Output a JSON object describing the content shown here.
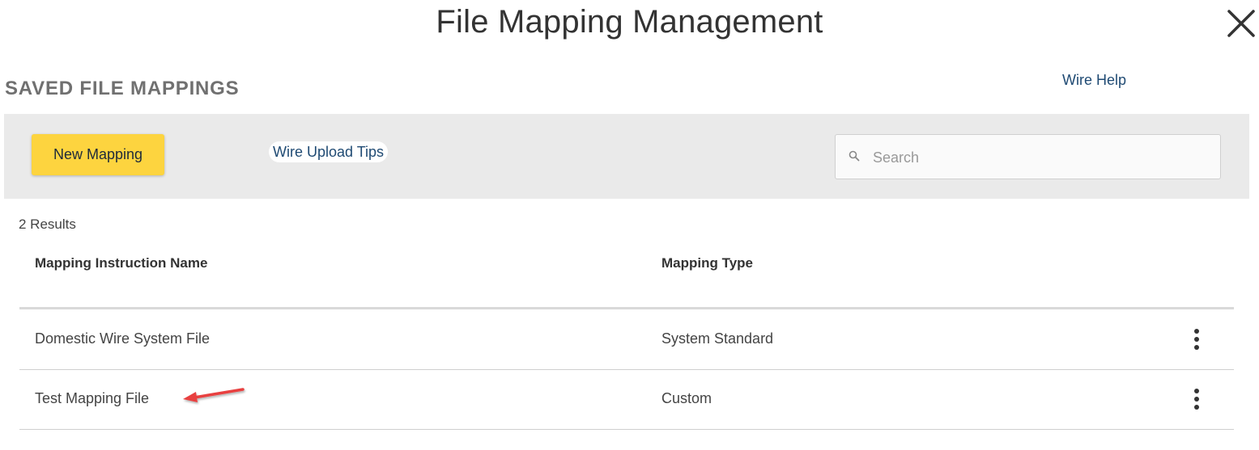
{
  "header": {
    "title": "File Mapping Management",
    "close_icon": "close-icon"
  },
  "section": {
    "title": "SAVED FILE MAPPINGS",
    "help_link": "Wire Help"
  },
  "toolbar": {
    "new_mapping_label": "New Mapping",
    "upload_tips_label": "Wire Upload Tips",
    "search": {
      "placeholder": "Search",
      "value": "",
      "icon": "search-icon"
    }
  },
  "results": {
    "count_label": "2 Results"
  },
  "table": {
    "columns": [
      "Mapping Instruction Name",
      "Mapping Type"
    ],
    "rows": [
      {
        "name": "Domestic Wire System File",
        "type": "System Standard",
        "menu_icon": "more-vertical-icon"
      },
      {
        "name": "Test Mapping File",
        "type": "Custom",
        "menu_icon": "more-vertical-icon"
      }
    ]
  },
  "annotation": {
    "type": "arrow",
    "points_to": "Test Mapping File",
    "color": "#e8403f"
  },
  "colors": {
    "primary_button": "#fdd43f",
    "link": "#1f4a73",
    "toolbar_bg": "#eaeaea"
  }
}
